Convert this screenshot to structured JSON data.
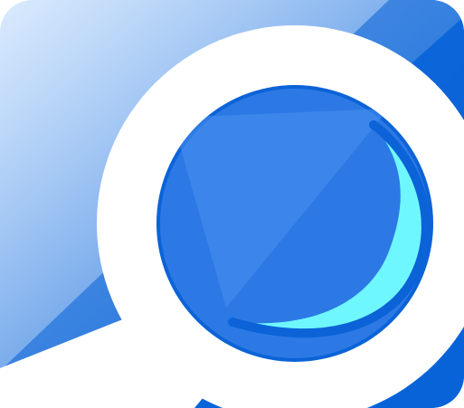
{
  "icon": {
    "name": "magnifier-search-icon",
    "colors": {
      "tile_blue": "#0863d8",
      "tile_light": "#b8d8fb",
      "ring_white": "#ffffff",
      "lens_blue": "#2c79e5",
      "lens_crescent": "#6ff7ff",
      "lens_edge": "#0b63d7"
    }
  }
}
